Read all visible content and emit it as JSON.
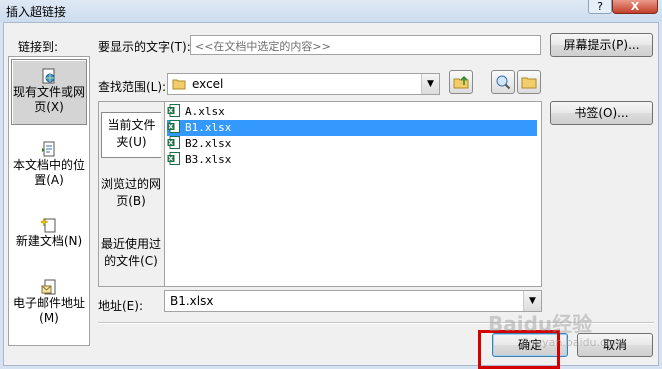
{
  "window": {
    "title": "插入超链接",
    "help": "?",
    "close": "X"
  },
  "link_to": {
    "label": "链接到:",
    "items": [
      {
        "label": "现有文件或网页(X)",
        "icon": "globe-page-icon",
        "selected": true
      },
      {
        "label": "本文档中的位置(A)",
        "icon": "document-place-icon",
        "selected": false
      },
      {
        "label": "新建文档(N)",
        "icon": "new-document-icon",
        "selected": false
      },
      {
        "label": "电子邮件地址(M)",
        "icon": "email-icon",
        "selected": false
      }
    ]
  },
  "display_text": {
    "label": "要显示的文字(T):",
    "value": "<<在文档中选定的内容>>"
  },
  "screen_tip_button": "屏幕提示(P)...",
  "look_in": {
    "label": "查找范围(L):",
    "value": "excel",
    "icon": "folder-icon"
  },
  "toolbar_icons": [
    "up-folder-icon",
    "browse-web-icon",
    "browse-file-icon"
  ],
  "inner_tabs": [
    {
      "label": "当前文件夹(U)",
      "selected": true
    },
    {
      "label": "浏览过的网页(B)",
      "selected": false
    },
    {
      "label": "最近使用过的文件(C)",
      "selected": false
    }
  ],
  "files": [
    {
      "name": "A.xlsx",
      "selected": false
    },
    {
      "name": "B1.xlsx",
      "selected": true
    },
    {
      "name": "B2.xlsx",
      "selected": false
    },
    {
      "name": "B3.xlsx",
      "selected": false
    }
  ],
  "bookmark_button": "书签(O)...",
  "address": {
    "label": "地址(E):",
    "value": "B1.xlsx"
  },
  "ok_button": "确定",
  "cancel_button": "取消",
  "watermark": {
    "main": "Baidu经验",
    "sub": "jingyan.baidu.com"
  },
  "colors": {
    "selection": "#3399ff",
    "highlight_box": "#d40000",
    "excel_green": "#1e7145"
  }
}
